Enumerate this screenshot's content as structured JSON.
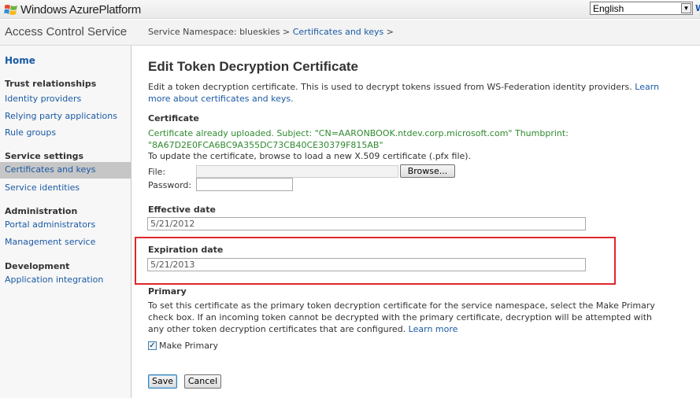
{
  "topbar": {
    "brand_part1": "Windows Azure",
    "brand_part2": "Platform",
    "language": "English",
    "corner_text": "W"
  },
  "header": {
    "service_title": "Access Control Service",
    "breadcrumb_prefix": "Service Namespace: blueskies > ",
    "breadcrumb_link": "Certificates and keys",
    "breadcrumb_suffix": " >"
  },
  "sidebar": {
    "home": "Home",
    "sections": [
      {
        "heading": "Trust relationships",
        "items": [
          "Identity providers",
          "Relying party applications",
          "Rule groups"
        ]
      },
      {
        "heading": "Service settings",
        "items": [
          "Certificates and keys",
          "Service identities"
        ]
      },
      {
        "heading": "Administration",
        "items": [
          "Portal administrators",
          "Management service"
        ]
      },
      {
        "heading": "Development",
        "items": [
          "Application integration"
        ]
      }
    ],
    "active_item": "Certificates and keys"
  },
  "main": {
    "title": "Edit Token Decryption Certificate",
    "description": "Edit a token decryption certificate. This is used to decrypt tokens issued from WS-Federation identity providers. ",
    "description_link": "Learn more about certificates and keys.",
    "certificate": {
      "label": "Certificate",
      "status": "Certificate already uploaded. Subject: \"CN=AARONBOOK.ntdev.corp.microsoft.com\" Thumbprint: \"8A67D2E0FCA6BC9A355DC73CB40CE30379F815AB\"",
      "help": "To update the certificate, browse to load a new X.509 certificate (.pfx file).",
      "file_label": "File:",
      "browse_label": "Browse...",
      "password_label": "Password:",
      "password_value": ""
    },
    "effective": {
      "label": "Effective date",
      "value": "5/21/2012"
    },
    "expiration": {
      "label": "Expiration date",
      "value": "5/21/2013"
    },
    "primary": {
      "label": "Primary",
      "description": "To set this certificate as the primary token decryption certificate for the service namespace, select the Make Primary check box. If an incoming token cannot be decrypted with the primary certificate, decryption will be attempted with any other token decryption certificates that are configured. ",
      "learn_more": "Learn more",
      "checkbox_label": "Make Primary",
      "checked": true
    },
    "buttons": {
      "save": "Save",
      "cancel": "Cancel"
    }
  },
  "colors": {
    "link": "#1a5aa5",
    "success_text": "#2f8a2f",
    "highlight_border": "#e0262b",
    "sidebar_active": "#c6c6c6"
  }
}
